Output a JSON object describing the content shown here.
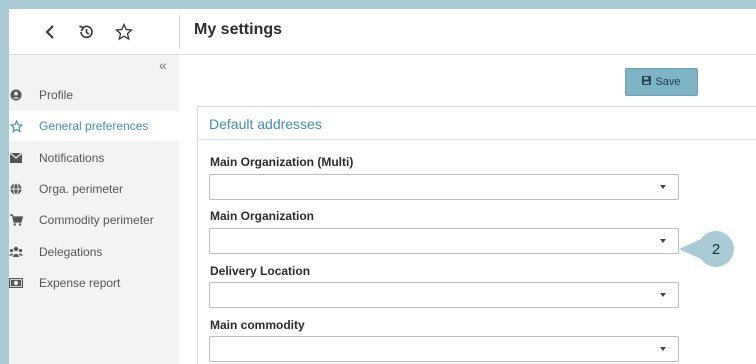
{
  "topbar": {
    "title": "My settings",
    "back_icon": "chevron-left-icon",
    "history_icon": "history-icon",
    "favorite_icon": "star-icon"
  },
  "sidebar": {
    "collapse_icon": "double-chevron-left-icon",
    "collapse_glyph": "«",
    "items": [
      {
        "label": "Profile",
        "icon": "user-icon",
        "active": false
      },
      {
        "label": "General preferences",
        "icon": "star-icon",
        "active": true
      },
      {
        "label": "Notifications",
        "icon": "envelope-icon",
        "active": false
      },
      {
        "label": "Orga. perimeter",
        "icon": "globe-icon",
        "active": false
      },
      {
        "label": "Commodity perimeter",
        "icon": "cart-icon",
        "active": false
      },
      {
        "label": "Delegations",
        "icon": "users-icon",
        "active": false
      },
      {
        "label": "Expense report",
        "icon": "money-icon",
        "active": false
      }
    ]
  },
  "toolbar": {
    "save_label": "Save",
    "save_icon": "floppy-disk-icon"
  },
  "panel": {
    "title": "Default addresses",
    "fields": [
      {
        "label": "Main Organization (Multi)",
        "value": ""
      },
      {
        "label": "Main Organization",
        "value": ""
      },
      {
        "label": "Delivery Location",
        "value": ""
      },
      {
        "label": "Main commodity",
        "value": ""
      }
    ]
  },
  "callout": {
    "number": "2"
  },
  "colors": {
    "accent": "#3f8fae",
    "save_button": "#7fb3c6",
    "callout": "#a9cbd6",
    "frame": "#a9cbd6"
  }
}
